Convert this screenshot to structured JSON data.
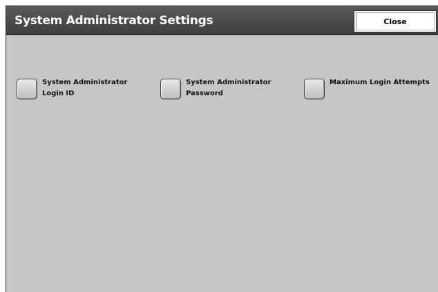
{
  "window": {
    "title": "System Administrator Settings",
    "close_label": "Close"
  },
  "options": [
    {
      "line1": "System Administrator",
      "line2": "Login ID"
    },
    {
      "line1": "System Administrator",
      "line2": "Password"
    },
    {
      "line1": "Maximum Login Attempts",
      "line2": ""
    }
  ],
  "colors": {
    "panel_background": "#c6c6c6",
    "title_bar": "#4a4a4a",
    "title_text": "#ffffff"
  }
}
